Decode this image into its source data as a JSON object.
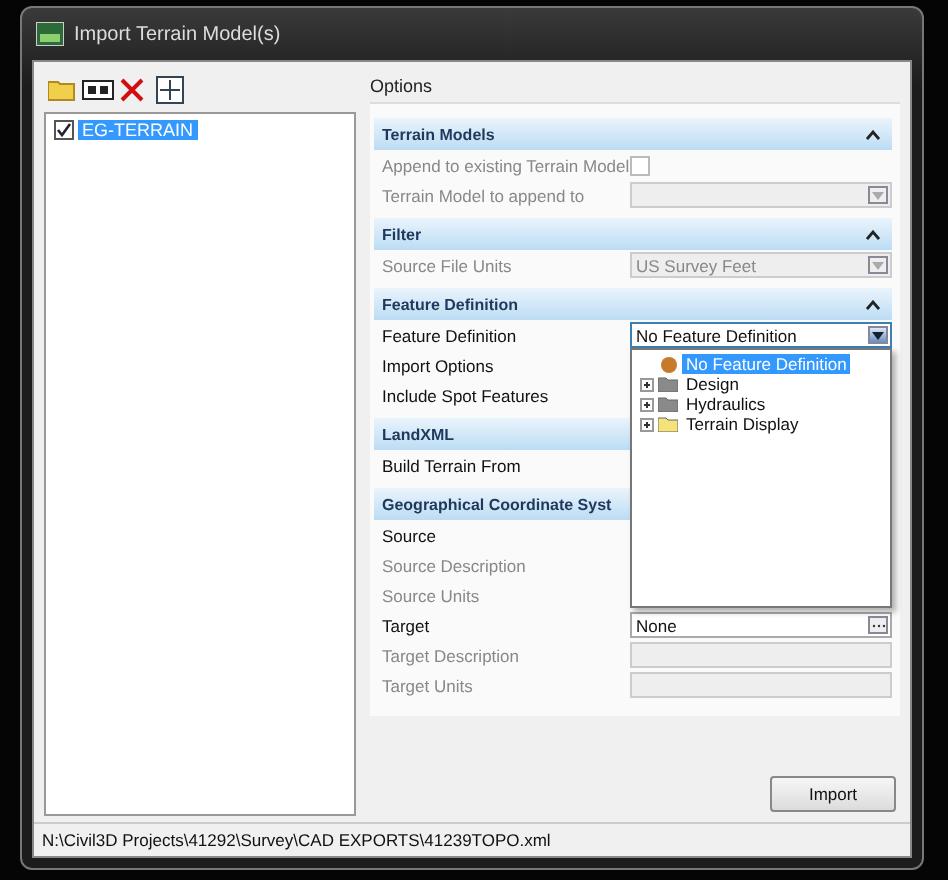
{
  "window": {
    "title": "Import Terrain Model(s)"
  },
  "tree": [
    {
      "label": "EG-TERRAIN",
      "checked": true,
      "selected": true
    }
  ],
  "options": {
    "label": "Options",
    "sections": [
      {
        "title": "Terrain Models",
        "expanded": true,
        "rows": [
          {
            "label": "Append to existing Terrain Model",
            "kind": "checkbox",
            "disabled": true,
            "checked": false
          },
          {
            "label": "Terrain Model to append to",
            "kind": "dropdown",
            "disabled": true
          }
        ]
      },
      {
        "title": "Filter",
        "expanded": true,
        "rows": [
          {
            "label": "Source File Units",
            "kind": "dropdown",
            "disabled": true,
            "value": "US Survey Feet"
          }
        ]
      },
      {
        "title": "Feature Definition",
        "expanded": true,
        "rows": [
          {
            "label": "Feature Definition",
            "kind": "dropdown",
            "disabled": false,
            "value": "No Feature Definition",
            "open": true
          },
          {
            "label": "Import Options",
            "kind": "text",
            "disabled": false
          },
          {
            "label": "Include Spot Features",
            "kind": "text",
            "disabled": false
          }
        ]
      },
      {
        "title": "LandXML",
        "rows": [
          {
            "label": "Build Terrain From",
            "kind": "text",
            "disabled": false
          }
        ]
      },
      {
        "title": "Geographical Coordinate Syst",
        "rows": [
          {
            "label": "Source",
            "kind": "text",
            "disabled": false
          },
          {
            "label": "Source Description",
            "kind": "text",
            "disabled": true
          },
          {
            "label": "Source Units",
            "kind": "text",
            "disabled": true
          },
          {
            "label": "Target",
            "kind": "browse",
            "disabled": false,
            "value": "None"
          },
          {
            "label": "Target Description",
            "kind": "text",
            "disabled": true
          },
          {
            "label": "Target Units",
            "kind": "text",
            "disabled": true
          }
        ]
      }
    ]
  },
  "dropdown_popup": {
    "items": [
      {
        "label": "No Feature Definition",
        "kind": "item",
        "selected": true
      },
      {
        "label": "Design",
        "kind": "folder",
        "selected": false,
        "color": "#8a8a8a"
      },
      {
        "label": "Hydraulics",
        "kind": "folder",
        "selected": false,
        "color": "#8a8a8a"
      },
      {
        "label": "Terrain Display",
        "kind": "folder",
        "selected": false,
        "color": "#f5e27a"
      }
    ]
  },
  "import_button": "Import",
  "status_bar": "N:\\Civil3D Projects\\41292\\Survey\\CAD EXPORTS\\41239TOPO.xml"
}
